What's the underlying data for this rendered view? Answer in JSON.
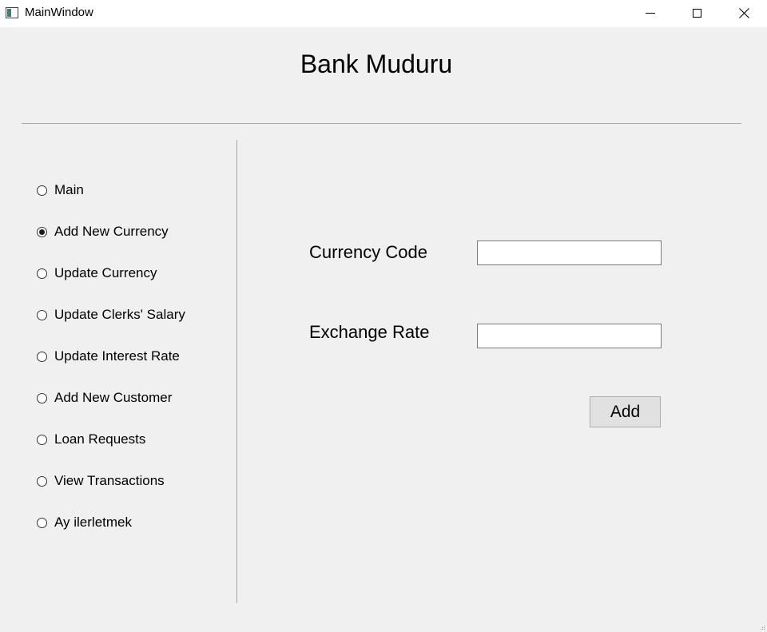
{
  "window": {
    "title": "MainWindow",
    "icon": "app-window-icon",
    "controls": [
      "minimize-icon",
      "maximize-icon",
      "close-icon"
    ]
  },
  "header": {
    "title": "Bank Muduru"
  },
  "sidebar": {
    "selected": "Add New Currency",
    "items": [
      {
        "label": "Main",
        "checked": false
      },
      {
        "label": "Add New Currency",
        "checked": true
      },
      {
        "label": "Update Currency",
        "checked": false
      },
      {
        "label": "Update Clerks' Salary",
        "checked": false
      },
      {
        "label": "Update Interest Rate",
        "checked": false
      },
      {
        "label": "Add New Customer",
        "checked": false
      },
      {
        "label": "Loan Requests",
        "checked": false
      },
      {
        "label": "View Transactions",
        "checked": false
      },
      {
        "label": "Ay ilerletmek",
        "checked": false
      }
    ]
  },
  "form": {
    "currency_code_label": "Currency Code",
    "currency_code_value": "",
    "exchange_rate_label": "Exchange Rate",
    "exchange_rate_value": "",
    "add_button_label": "Add"
  }
}
